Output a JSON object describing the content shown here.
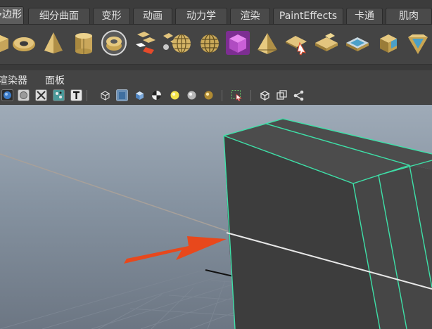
{
  "shelf_tabs": {
    "items": [
      {
        "label": "多边形",
        "active": true
      },
      {
        "label": "细分曲面"
      },
      {
        "label": "变形"
      },
      {
        "label": "动画"
      },
      {
        "label": "动力学"
      },
      {
        "label": "渲染"
      },
      {
        "label": "PaintEffects"
      },
      {
        "label": "卡通"
      },
      {
        "label": "肌肉"
      }
    ]
  },
  "shelf": {
    "icons": [
      "cube-icon",
      "torus-icon",
      "cone-icon",
      "cylinder-icon",
      "pipe-icon",
      "combine-icon",
      "separate-icon",
      "sphere-icon",
      "sphere-wire-icon",
      "purple-cube-icon",
      "pyramid-icon",
      "plane-arrow-icon",
      "plane-icon",
      "bevel-icon",
      "extrude-icon",
      "prism-icon"
    ]
  },
  "panel_menu": {
    "renderer_label": "渲染器",
    "panels_label": "面板"
  },
  "viewport_toolbar": {
    "icons": [
      "sphere-shade-icon",
      "circle-icon",
      "checker-icon",
      "texture-icon",
      "text-icon",
      "wire-cube-icon",
      "smooth-cube-icon",
      "shaded-cube-icon",
      "checker-ball-icon",
      "light-bulb-icon",
      "grey-sphere-icon",
      "gold-sphere-icon",
      "select-region-icon",
      "isolate-cube-icon",
      "frame-icon",
      "share-nodes-icon"
    ]
  },
  "viewport": {
    "object": "selected-box",
    "wire_color": "#3ee0a8",
    "arrow_color": "#e8481c",
    "object_color": "#3f3f3f"
  }
}
